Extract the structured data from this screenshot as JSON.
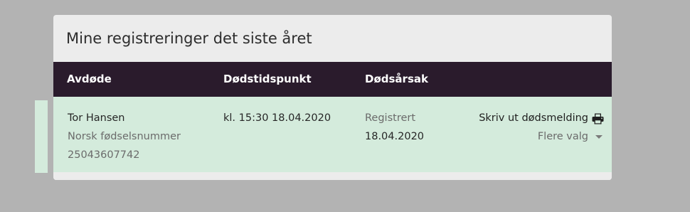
{
  "card": {
    "title": "Mine registreringer det siste året"
  },
  "table": {
    "headers": [
      "Avdøde",
      "Dødstidspunkt",
      "Dødsårsak",
      ""
    ],
    "rows": [
      {
        "name": "Tor Hansen",
        "id_label": "Norsk fødselsnummer",
        "id_value": "25043607742",
        "time_of_death": "kl. 15:30 18.04.2020",
        "cause_status": "Registrert",
        "cause_date": "18.04.2020",
        "print_label": "Skriv ut dødsmelding",
        "more_label": "Flere valg"
      }
    ]
  },
  "icons": {
    "print": "printer-icon",
    "more": "caret-down-icon"
  },
  "colors": {
    "header_bg": "#2a1b2c",
    "row_bg": "#d4ebdc",
    "page_bg": "#b3b3b3",
    "card_bg": "#ececec"
  }
}
